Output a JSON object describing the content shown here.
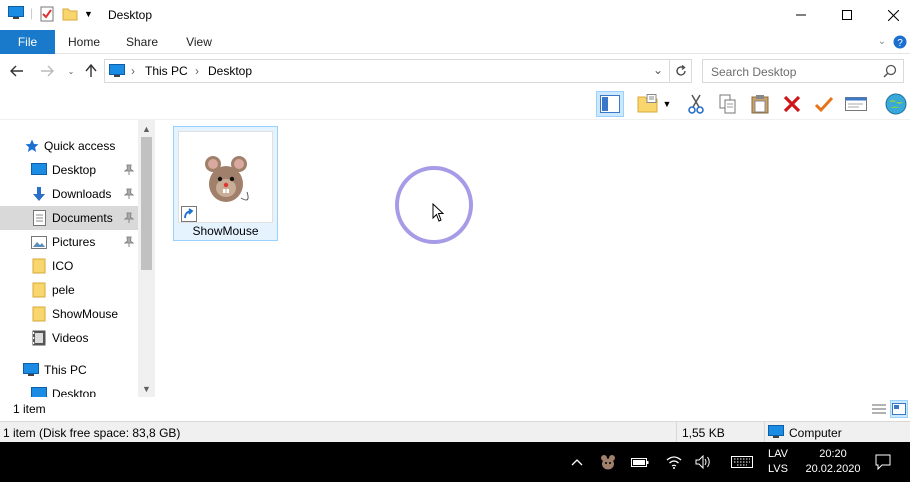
{
  "window": {
    "title": "Desktop"
  },
  "ribbon": {
    "tabs": [
      {
        "label": "File"
      },
      {
        "label": "Home"
      },
      {
        "label": "Share"
      },
      {
        "label": "View"
      }
    ]
  },
  "address": {
    "crumbs": [
      "This PC",
      "Desktop"
    ],
    "search_placeholder": "Search Desktop"
  },
  "nav": {
    "quick_access": "Quick access",
    "items": [
      {
        "label": "Desktop",
        "icon": "desktop-icon",
        "pinned": true
      },
      {
        "label": "Downloads",
        "icon": "download-icon",
        "pinned": true
      },
      {
        "label": "Documents",
        "icon": "document-icon",
        "pinned": true,
        "selected": true
      },
      {
        "label": "Pictures",
        "icon": "pictures-icon",
        "pinned": true
      },
      {
        "label": "ICO",
        "icon": "folder-icon"
      },
      {
        "label": "pele",
        "icon": "folder-icon"
      },
      {
        "label": "ShowMouse",
        "icon": "folder-icon"
      },
      {
        "label": "Videos",
        "icon": "video-icon"
      }
    ],
    "this_pc": "This PC",
    "this_pc_child": "Desktop"
  },
  "files": [
    {
      "name": "ShowMouse",
      "icon": "mouse-shortcut-icon"
    }
  ],
  "status": {
    "count": "1 item",
    "info": "1 item (Disk free space: 83,8 GB)",
    "size": "1,55 KB",
    "location": "Computer"
  },
  "taskbar": {
    "lang_top": "LAV",
    "lang_bottom": "LVS",
    "time": "20:20",
    "date": "20.02.2020"
  },
  "colors": {
    "accent": "#1979ca",
    "selection": "#cce8ff",
    "cursor_ring": "#a59be6"
  }
}
